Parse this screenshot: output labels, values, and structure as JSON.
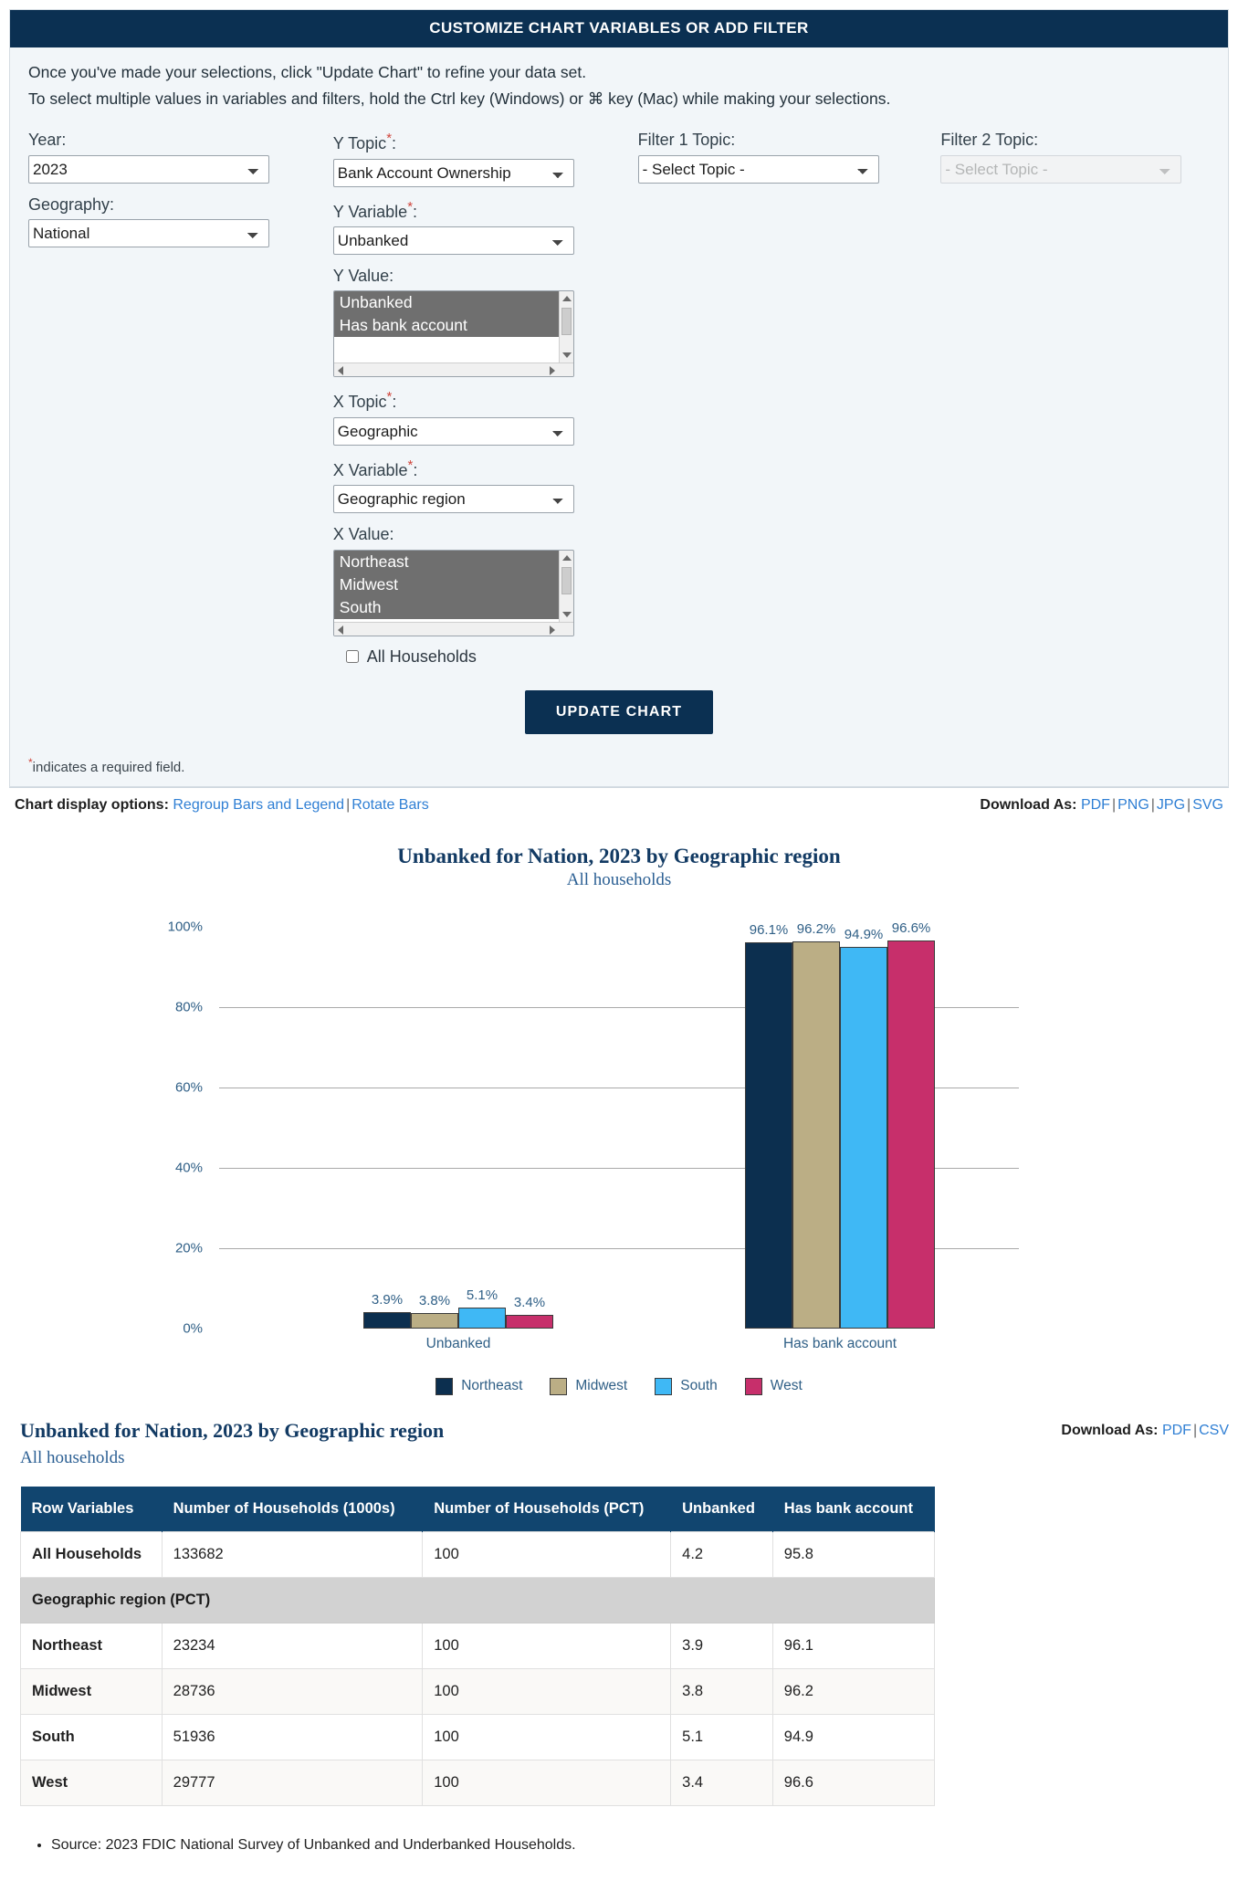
{
  "panel": {
    "header": "CUSTOMIZE CHART VARIABLES OR ADD FILTER",
    "intro_line1": "Once you've made your selections, click \"Update Chart\" to refine your data set.",
    "intro_line2": "To select multiple values in variables and filters, hold the Ctrl key (Windows) or ⌘ key (Mac) while making your selections.",
    "required_note": "indicates a required field.",
    "update_button": "UPDATE CHART"
  },
  "form": {
    "year": {
      "label": "Year:",
      "value": "2023"
    },
    "geography": {
      "label": "Geography:",
      "value": "National"
    },
    "y_topic": {
      "label": "Y Topic",
      "value": "Bank Account Ownership"
    },
    "y_variable": {
      "label": "Y Variable",
      "value": "Unbanked"
    },
    "y_value": {
      "label": "Y Value:",
      "options": [
        "Unbanked",
        "Has bank account"
      ],
      "selected": [
        "Unbanked",
        "Has bank account"
      ]
    },
    "x_topic": {
      "label": "X Topic",
      "value": "Geographic"
    },
    "x_variable": {
      "label": "X Variable",
      "value": "Geographic region"
    },
    "x_value": {
      "label": "X Value:",
      "options": [
        "Northeast",
        "Midwest",
        "South"
      ],
      "selected": [
        "Northeast",
        "Midwest",
        "South"
      ]
    },
    "all_households": {
      "label": "All Households",
      "checked": false
    },
    "filter1": {
      "label": "Filter 1 Topic:",
      "value": "- Select Topic -",
      "disabled": false
    },
    "filter2": {
      "label": "Filter 2 Topic:",
      "value": "- Select Topic -",
      "disabled": true
    }
  },
  "display_options": {
    "label": "Chart display options:",
    "regroup": "Regroup Bars and Legend",
    "rotate": "Rotate Bars",
    "download_label": "Download As:",
    "formats": [
      "PDF",
      "PNG",
      "JPG",
      "SVG"
    ]
  },
  "chart_data": {
    "type": "bar",
    "title": "Unbanked for Nation, 2023 by Geographic region",
    "subtitle": "All households",
    "xlabel": "",
    "ylabel": "",
    "ylim": [
      0,
      100
    ],
    "ytick_labels": [
      "100%",
      "80%",
      "60%",
      "40%",
      "20%",
      "0%"
    ],
    "ytick_values": [
      100,
      80,
      60,
      40,
      20,
      0
    ],
    "gridlines_at": [
      80,
      60,
      40,
      20
    ],
    "legend_position": "bottom",
    "categories": [
      "Unbanked",
      "Has bank account"
    ],
    "series": [
      {
        "name": "Northeast",
        "color": "#0c2f4f",
        "values": [
          3.9,
          96.1
        ],
        "labels": [
          "3.9%",
          "96.1%"
        ]
      },
      {
        "name": "Midwest",
        "color": "#bbae85",
        "values": [
          3.8,
          96.2
        ],
        "labels": [
          "3.8%",
          "96.2%"
        ]
      },
      {
        "name": "South",
        "color": "#3fb8f5",
        "values": [
          5.1,
          94.9
        ],
        "labels": [
          "5.1%",
          "94.9%"
        ]
      },
      {
        "name": "West",
        "color": "#c72f6b",
        "values": [
          3.4,
          96.6
        ],
        "labels": [
          "3.4%",
          "96.6%"
        ]
      }
    ]
  },
  "table_section": {
    "title": "Unbanked for Nation, 2023 by Geographic region",
    "subtitle": "All households",
    "download_label": "Download As:",
    "formats": [
      "PDF",
      "CSV"
    ],
    "columns": [
      "Row Variables",
      "Number of Households (1000s)",
      "Number of Households (PCT)",
      "Unbanked",
      "Has bank account"
    ],
    "rows": [
      {
        "type": "data",
        "cells": [
          "All Households",
          "133682",
          "100",
          "4.2",
          "95.8"
        ]
      },
      {
        "type": "section",
        "cells": [
          "Geographic region (PCT)"
        ]
      },
      {
        "type": "data",
        "cells": [
          "Northeast",
          "23234",
          "100",
          "3.9",
          "96.1"
        ]
      },
      {
        "type": "data",
        "cells": [
          "Midwest",
          "28736",
          "100",
          "3.8",
          "96.2"
        ]
      },
      {
        "type": "data",
        "cells": [
          "South",
          "51936",
          "100",
          "5.1",
          "94.9"
        ]
      },
      {
        "type": "data",
        "cells": [
          "West",
          "29777",
          "100",
          "3.4",
          "96.6"
        ]
      }
    ]
  },
  "footnotes": [
    "Source: 2023 FDIC National Survey of Unbanked and Underbanked Households."
  ]
}
